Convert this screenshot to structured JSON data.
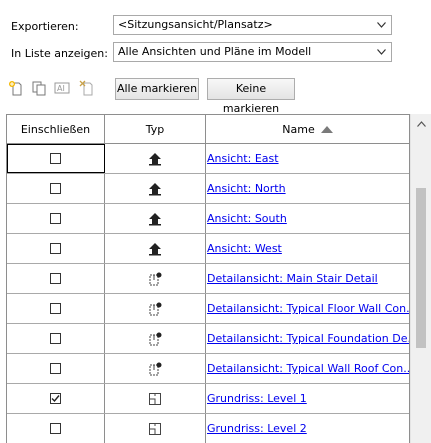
{
  "form": {
    "export_label": "Exportieren:",
    "export_value": "<Sitzungsansicht/Plansatz>",
    "show_label": "In Liste anzeigen:",
    "show_value": "Alle Ansichten und Pläne im Modell"
  },
  "toolbar": {
    "mark_all": "Alle markieren",
    "mark_none": "Keine markieren",
    "icons": [
      "new-sheet-set-icon",
      "duplicate-icon",
      "rename-icon",
      "delete-icon"
    ]
  },
  "table": {
    "columns": [
      "Einschließen",
      "Typ",
      "Name"
    ],
    "sort": "ascending",
    "rows": [
      {
        "checked": false,
        "type": "elevation",
        "name": "Ansicht: East"
      },
      {
        "checked": false,
        "type": "elevation",
        "name": "Ansicht: North"
      },
      {
        "checked": false,
        "type": "elevation",
        "name": "Ansicht: South"
      },
      {
        "checked": false,
        "type": "elevation",
        "name": "Ansicht: West"
      },
      {
        "checked": false,
        "type": "detail",
        "name": "Detailansicht: Main Stair Detail"
      },
      {
        "checked": false,
        "type": "detail",
        "name": "Detailansicht: Typical Floor Wall Con..."
      },
      {
        "checked": false,
        "type": "detail",
        "name": "Detailansicht: Typical Foundation De..."
      },
      {
        "checked": false,
        "type": "detail",
        "name": "Detailansicht: Typical Wall Roof Con..."
      },
      {
        "checked": true,
        "type": "floorplan",
        "name": "Grundriss: Level 1"
      },
      {
        "checked": false,
        "type": "floorplan",
        "name": "Grundriss: Level 2"
      }
    ]
  },
  "colors": {
    "link": "#0000ee",
    "grid_border": "#8e8e8e"
  }
}
